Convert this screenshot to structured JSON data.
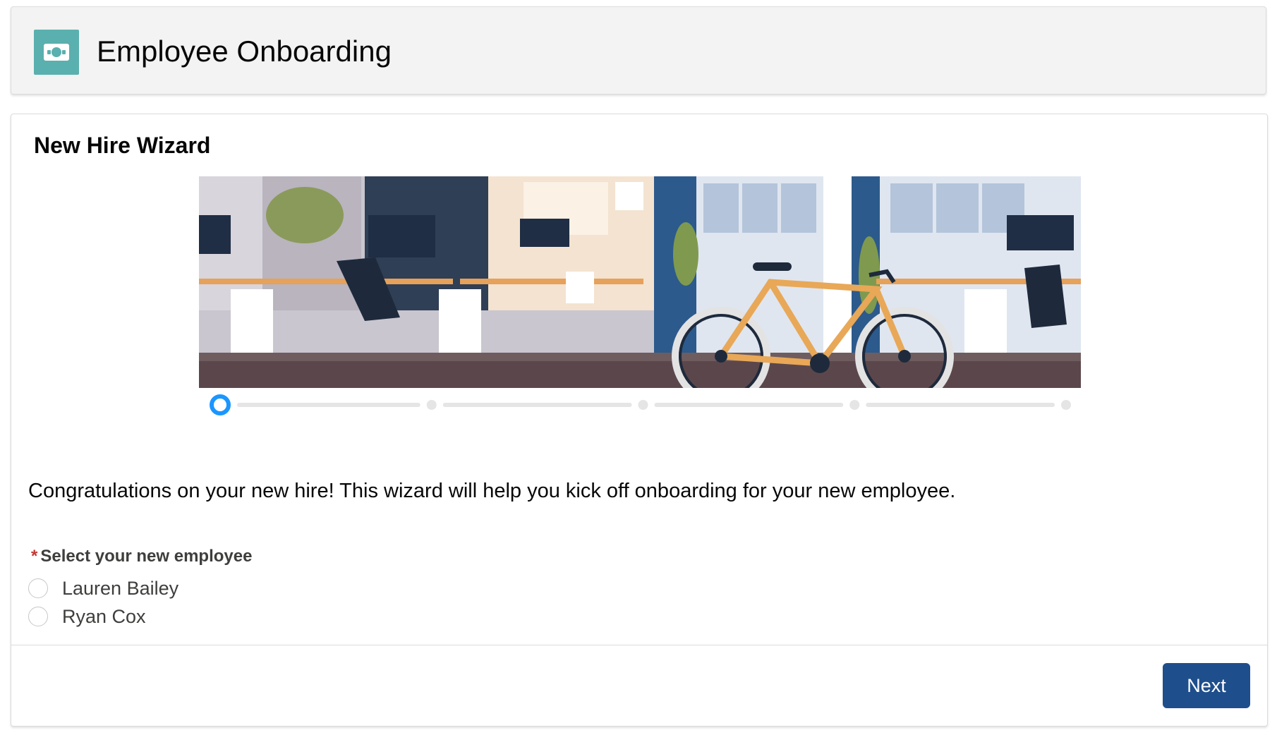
{
  "header": {
    "title": "Employee Onboarding",
    "icon": "money-icon",
    "icon_color": "#5ab0ae"
  },
  "wizard": {
    "title": "New Hire Wizard",
    "banner_icon": "office-illustration",
    "progress": {
      "current_step": 1,
      "total_steps": 5
    },
    "intro_text": "Congratulations on your new hire! This wizard will help you kick off onboarding for your new employee.",
    "field": {
      "required_marker": "*",
      "label": "Select your new employee",
      "options": [
        "Lauren Bailey",
        "Ryan Cox"
      ]
    },
    "next_label": "Next"
  },
  "colors": {
    "accent": "#1f4e8c",
    "progress_active": "#1b96ff",
    "progress_inactive": "#e5e5e5",
    "required": "#c23934"
  }
}
